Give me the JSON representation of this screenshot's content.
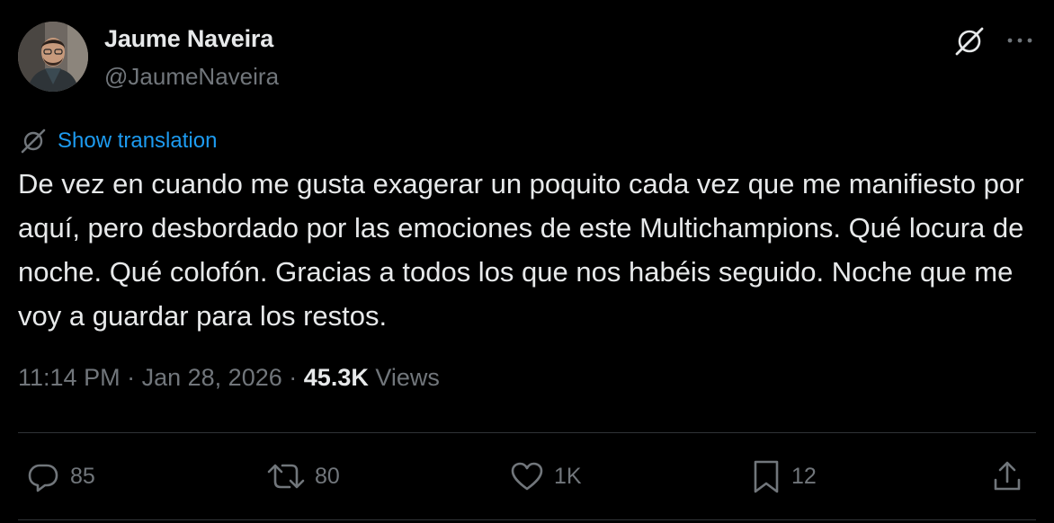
{
  "author": {
    "display_name": "Jaume Naveira",
    "handle": "@JaumeNaveira"
  },
  "header": {
    "grok_icon": "grok-icon",
    "more_icon": "more-icon"
  },
  "translation": {
    "label": "Show translation"
  },
  "tweet": {
    "text": "De vez en cuando me gusta exagerar un poquito cada vez que me manifiesto por aquí, pero desbordado por las emociones de este Multichampions. Qué locura de noche. Qué colofón. Gracias a todos los que nos habéis seguido. Noche que me voy a guardar para los restos."
  },
  "meta": {
    "time": "11:14 PM",
    "separator": "·",
    "date": "Jan 28, 2026",
    "views_count": "45.3K",
    "views_label": "Views"
  },
  "actions": {
    "replies": "85",
    "retweets": "80",
    "likes": "1K",
    "bookmarks": "12"
  },
  "colors": {
    "background": "#000000",
    "text": "#e7e9ea",
    "secondary": "#71767b",
    "link": "#1d9bf0",
    "divider": "#2f3336"
  }
}
